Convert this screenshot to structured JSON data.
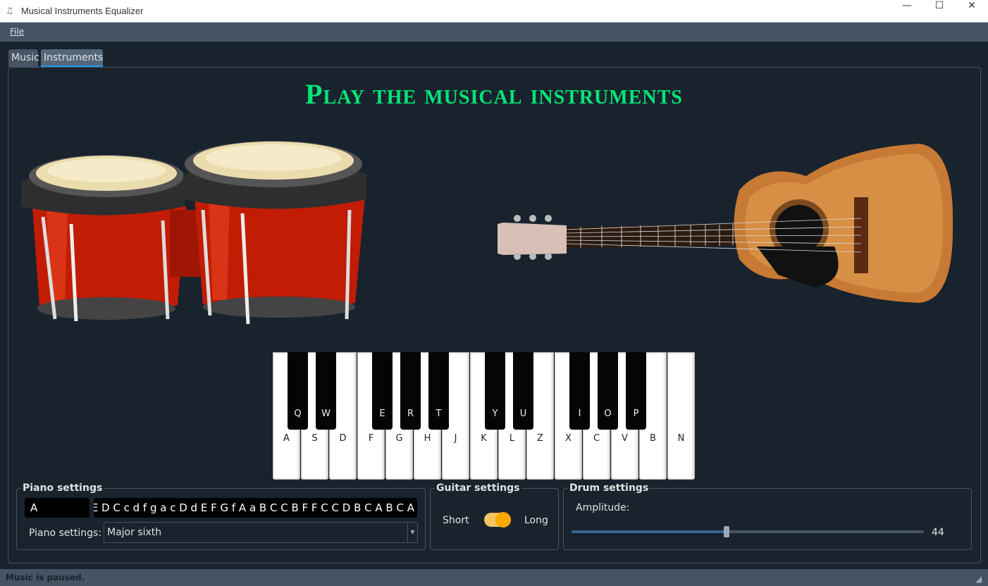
{
  "window": {
    "title": "Musical Instruments Equalizer",
    "minimize": "—",
    "maximize": "☐",
    "close": "✕"
  },
  "menu": {
    "file": "File"
  },
  "tabs": [
    {
      "label": "Music"
    },
    {
      "label": "Instruments"
    }
  ],
  "heading": "Play the musical instruments",
  "piano": {
    "white_keys": [
      "A",
      "S",
      "D",
      "F",
      "G",
      "H",
      "J",
      "K",
      "L",
      "Z",
      "X",
      "C",
      "V",
      "B",
      "N"
    ],
    "black_keys": [
      "Q",
      "W",
      "E",
      "R",
      "T",
      "Y",
      "U",
      "I",
      "O",
      "P"
    ]
  },
  "piano_settings": {
    "title": "Piano settings",
    "current_note": "A",
    "note_sequence": "B C E D C c d f g a c D d E F G f A a B C C B F F C C D B C A B C A",
    "mode_label": "Piano settings:",
    "mode_value": "Major sixth"
  },
  "guitar_settings": {
    "title": "Guitar settings",
    "short": "Short",
    "long": "Long",
    "toggle_on": true
  },
  "drum_settings": {
    "title": "Drum settings",
    "amplitude_label": "Amplitude:",
    "amplitude_value": "44",
    "amplitude_fraction": 0.44
  },
  "status": "Music is paused.",
  "colors": {
    "accent": "#259ae9",
    "heading": "#00e676",
    "toggle": "#ffa800"
  }
}
